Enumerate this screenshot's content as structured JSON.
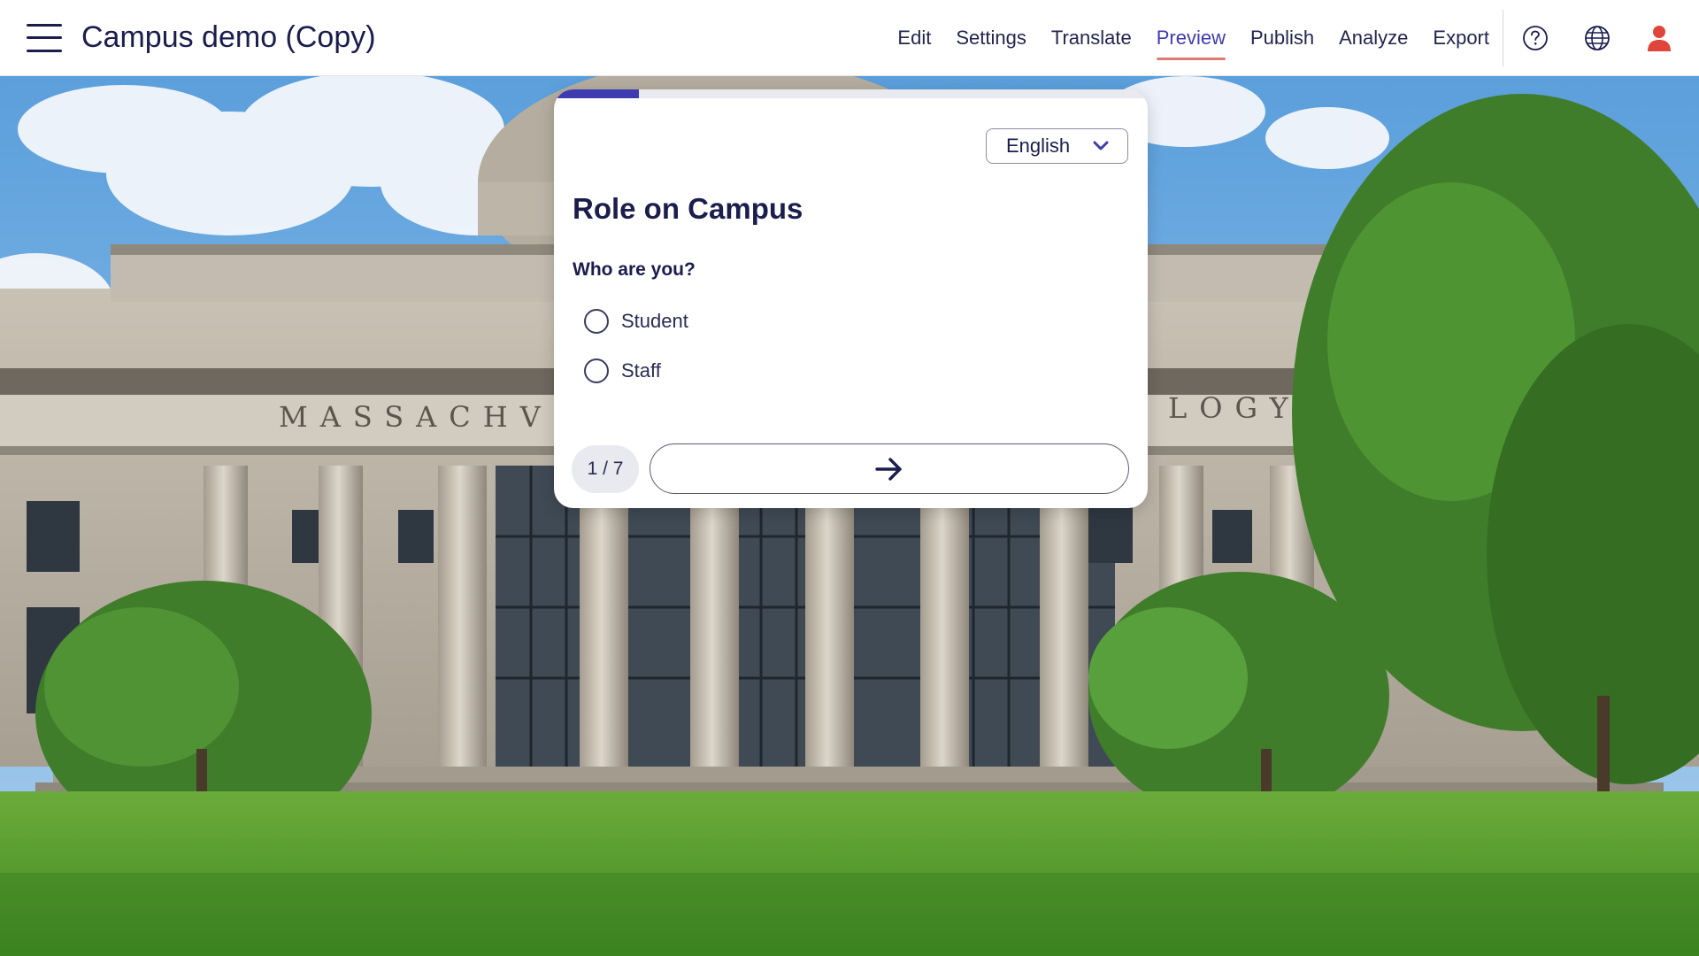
{
  "app": {
    "title": "Campus demo (Copy)"
  },
  "nav": {
    "items": [
      {
        "label": "Edit"
      },
      {
        "label": "Settings"
      },
      {
        "label": "Translate"
      },
      {
        "label": "Preview",
        "active": true
      },
      {
        "label": "Publish"
      },
      {
        "label": "Analyze"
      },
      {
        "label": "Export"
      }
    ],
    "icons": [
      "help-icon",
      "globe-icon",
      "user-icon"
    ]
  },
  "background": {
    "inscription_left": "MASSACHVSE",
    "inscription_right": "LOGY"
  },
  "survey": {
    "progress": 0.143,
    "language": "English",
    "title": "Role on Campus",
    "question": "Who are you?",
    "options": [
      "Student",
      "Staff"
    ],
    "page_indicator": "1 / 7",
    "next_icon": "arrow-right-icon"
  },
  "colors": {
    "primary": "#3f3bb0",
    "text": "#1b1d4d",
    "active_underline": "#e07a6e"
  }
}
